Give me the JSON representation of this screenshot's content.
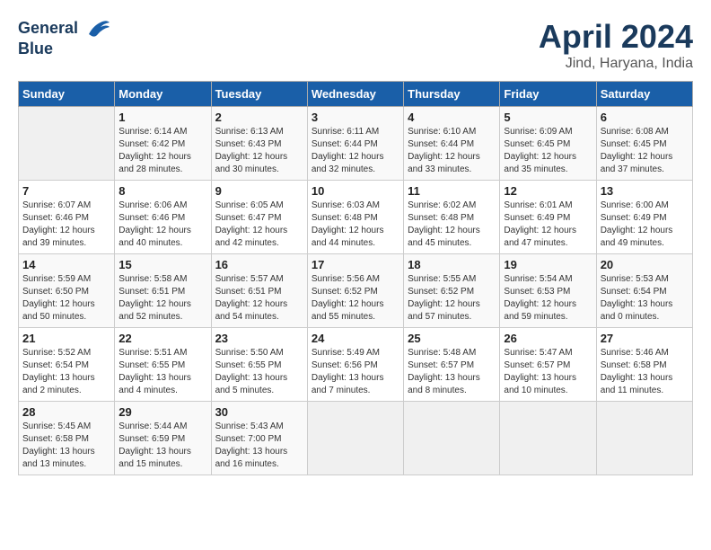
{
  "header": {
    "logo_line1": "General",
    "logo_line2": "Blue",
    "month_year": "April 2024",
    "location": "Jind, Haryana, India"
  },
  "days_of_week": [
    "Sunday",
    "Monday",
    "Tuesday",
    "Wednesday",
    "Thursday",
    "Friday",
    "Saturday"
  ],
  "weeks": [
    [
      {
        "day": "",
        "sunrise": "",
        "sunset": "",
        "daylight": "",
        "empty": true
      },
      {
        "day": "1",
        "sunrise": "Sunrise: 6:14 AM",
        "sunset": "Sunset: 6:42 PM",
        "daylight": "Daylight: 12 hours and 28 minutes."
      },
      {
        "day": "2",
        "sunrise": "Sunrise: 6:13 AM",
        "sunset": "Sunset: 6:43 PM",
        "daylight": "Daylight: 12 hours and 30 minutes."
      },
      {
        "day": "3",
        "sunrise": "Sunrise: 6:11 AM",
        "sunset": "Sunset: 6:44 PM",
        "daylight": "Daylight: 12 hours and 32 minutes."
      },
      {
        "day": "4",
        "sunrise": "Sunrise: 6:10 AM",
        "sunset": "Sunset: 6:44 PM",
        "daylight": "Daylight: 12 hours and 33 minutes."
      },
      {
        "day": "5",
        "sunrise": "Sunrise: 6:09 AM",
        "sunset": "Sunset: 6:45 PM",
        "daylight": "Daylight: 12 hours and 35 minutes."
      },
      {
        "day": "6",
        "sunrise": "Sunrise: 6:08 AM",
        "sunset": "Sunset: 6:45 PM",
        "daylight": "Daylight: 12 hours and 37 minutes."
      }
    ],
    [
      {
        "day": "7",
        "sunrise": "Sunrise: 6:07 AM",
        "sunset": "Sunset: 6:46 PM",
        "daylight": "Daylight: 12 hours and 39 minutes."
      },
      {
        "day": "8",
        "sunrise": "Sunrise: 6:06 AM",
        "sunset": "Sunset: 6:46 PM",
        "daylight": "Daylight: 12 hours and 40 minutes."
      },
      {
        "day": "9",
        "sunrise": "Sunrise: 6:05 AM",
        "sunset": "Sunset: 6:47 PM",
        "daylight": "Daylight: 12 hours and 42 minutes."
      },
      {
        "day": "10",
        "sunrise": "Sunrise: 6:03 AM",
        "sunset": "Sunset: 6:48 PM",
        "daylight": "Daylight: 12 hours and 44 minutes."
      },
      {
        "day": "11",
        "sunrise": "Sunrise: 6:02 AM",
        "sunset": "Sunset: 6:48 PM",
        "daylight": "Daylight: 12 hours and 45 minutes."
      },
      {
        "day": "12",
        "sunrise": "Sunrise: 6:01 AM",
        "sunset": "Sunset: 6:49 PM",
        "daylight": "Daylight: 12 hours and 47 minutes."
      },
      {
        "day": "13",
        "sunrise": "Sunrise: 6:00 AM",
        "sunset": "Sunset: 6:49 PM",
        "daylight": "Daylight: 12 hours and 49 minutes."
      }
    ],
    [
      {
        "day": "14",
        "sunrise": "Sunrise: 5:59 AM",
        "sunset": "Sunset: 6:50 PM",
        "daylight": "Daylight: 12 hours and 50 minutes."
      },
      {
        "day": "15",
        "sunrise": "Sunrise: 5:58 AM",
        "sunset": "Sunset: 6:51 PM",
        "daylight": "Daylight: 12 hours and 52 minutes."
      },
      {
        "day": "16",
        "sunrise": "Sunrise: 5:57 AM",
        "sunset": "Sunset: 6:51 PM",
        "daylight": "Daylight: 12 hours and 54 minutes."
      },
      {
        "day": "17",
        "sunrise": "Sunrise: 5:56 AM",
        "sunset": "Sunset: 6:52 PM",
        "daylight": "Daylight: 12 hours and 55 minutes."
      },
      {
        "day": "18",
        "sunrise": "Sunrise: 5:55 AM",
        "sunset": "Sunset: 6:52 PM",
        "daylight": "Daylight: 12 hours and 57 minutes."
      },
      {
        "day": "19",
        "sunrise": "Sunrise: 5:54 AM",
        "sunset": "Sunset: 6:53 PM",
        "daylight": "Daylight: 12 hours and 59 minutes."
      },
      {
        "day": "20",
        "sunrise": "Sunrise: 5:53 AM",
        "sunset": "Sunset: 6:54 PM",
        "daylight": "Daylight: 13 hours and 0 minutes."
      }
    ],
    [
      {
        "day": "21",
        "sunrise": "Sunrise: 5:52 AM",
        "sunset": "Sunset: 6:54 PM",
        "daylight": "Daylight: 13 hours and 2 minutes."
      },
      {
        "day": "22",
        "sunrise": "Sunrise: 5:51 AM",
        "sunset": "Sunset: 6:55 PM",
        "daylight": "Daylight: 13 hours and 4 minutes."
      },
      {
        "day": "23",
        "sunrise": "Sunrise: 5:50 AM",
        "sunset": "Sunset: 6:55 PM",
        "daylight": "Daylight: 13 hours and 5 minutes."
      },
      {
        "day": "24",
        "sunrise": "Sunrise: 5:49 AM",
        "sunset": "Sunset: 6:56 PM",
        "daylight": "Daylight: 13 hours and 7 minutes."
      },
      {
        "day": "25",
        "sunrise": "Sunrise: 5:48 AM",
        "sunset": "Sunset: 6:57 PM",
        "daylight": "Daylight: 13 hours and 8 minutes."
      },
      {
        "day": "26",
        "sunrise": "Sunrise: 5:47 AM",
        "sunset": "Sunset: 6:57 PM",
        "daylight": "Daylight: 13 hours and 10 minutes."
      },
      {
        "day": "27",
        "sunrise": "Sunrise: 5:46 AM",
        "sunset": "Sunset: 6:58 PM",
        "daylight": "Daylight: 13 hours and 11 minutes."
      }
    ],
    [
      {
        "day": "28",
        "sunrise": "Sunrise: 5:45 AM",
        "sunset": "Sunset: 6:58 PM",
        "daylight": "Daylight: 13 hours and 13 minutes."
      },
      {
        "day": "29",
        "sunrise": "Sunrise: 5:44 AM",
        "sunset": "Sunset: 6:59 PM",
        "daylight": "Daylight: 13 hours and 15 minutes."
      },
      {
        "day": "30",
        "sunrise": "Sunrise: 5:43 AM",
        "sunset": "Sunset: 7:00 PM",
        "daylight": "Daylight: 13 hours and 16 minutes."
      },
      {
        "day": "",
        "sunrise": "",
        "sunset": "",
        "daylight": "",
        "empty": true
      },
      {
        "day": "",
        "sunrise": "",
        "sunset": "",
        "daylight": "",
        "empty": true
      },
      {
        "day": "",
        "sunrise": "",
        "sunset": "",
        "daylight": "",
        "empty": true
      },
      {
        "day": "",
        "sunrise": "",
        "sunset": "",
        "daylight": "",
        "empty": true
      }
    ]
  ]
}
